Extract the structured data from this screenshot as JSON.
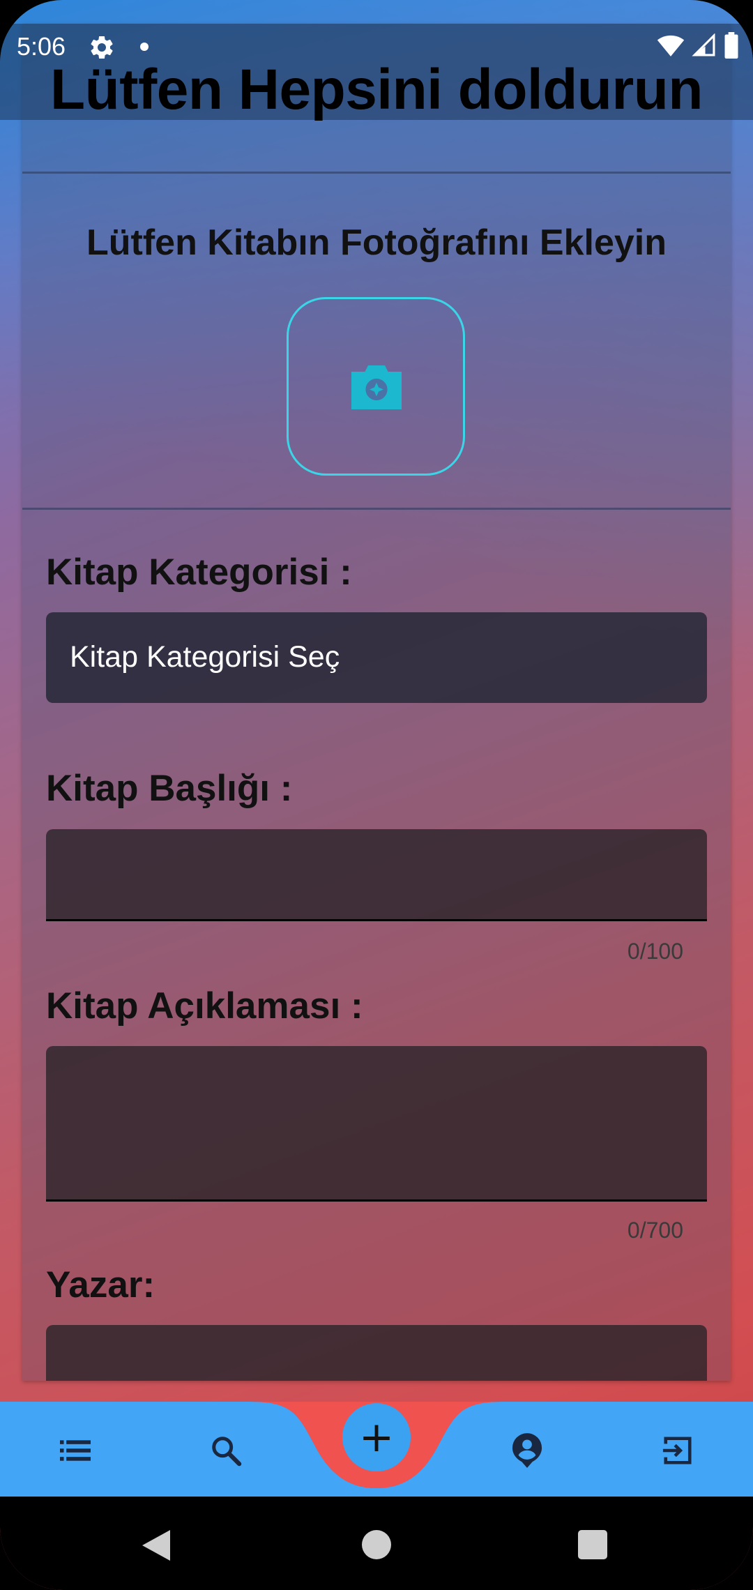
{
  "status_bar": {
    "time": "5:06",
    "icons": [
      "gear-icon",
      "notification-dot",
      "wifi-icon",
      "signal-icon",
      "battery-icon"
    ]
  },
  "page": {
    "title": "Lütfen Hepsini doldurun"
  },
  "photo": {
    "label": "Lütfen Kitabın Fotoğrafını Ekleyin",
    "icon": "add-photo-camera-icon",
    "accent_color": "#3ad6e8"
  },
  "form": {
    "category": {
      "label": "Kitap Kategorisi :",
      "selected": "Kitap Kategorisi Seç"
    },
    "title": {
      "label": "Kitap Başlığı :",
      "value": "",
      "counter": "0/100"
    },
    "description": {
      "label": "Kitap Açıklaması :",
      "value": "",
      "counter": "0/700"
    },
    "author": {
      "label": "Yazar:",
      "value": ""
    }
  },
  "bottom_nav": {
    "bar_color": "#42a5f5",
    "notch_color": "#f0524f",
    "items": [
      {
        "name": "list",
        "icon": "list-icon"
      },
      {
        "name": "search",
        "icon": "search-icon"
      },
      {
        "name": "add",
        "icon": "plus-icon",
        "label": "+"
      },
      {
        "name": "profile",
        "icon": "account-pin-icon"
      },
      {
        "name": "logout",
        "icon": "exit-icon"
      }
    ]
  },
  "system_nav": {
    "items": [
      "back-icon",
      "home-icon",
      "recents-icon"
    ]
  }
}
